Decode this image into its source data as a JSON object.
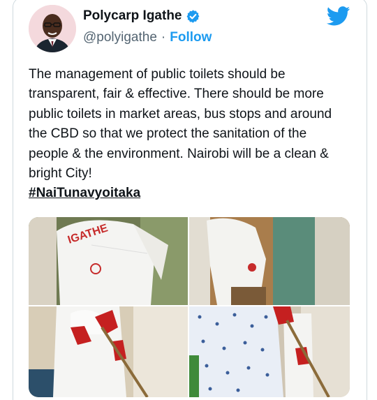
{
  "author": {
    "display_name": "Polycarp Igathe",
    "handle": "@polyigathe",
    "separator": "·",
    "follow_label": "Follow",
    "verified": true
  },
  "tweet": {
    "text": "The management of public toilets should be transparent, fair & effective. There should be more public toilets in market areas, bus stops and around the CBD so that we protect the sanitation of the people & the environment. Nairobi will be a clean & bright City!",
    "hashtag": "#NaiTunavyoitaka"
  },
  "media": {
    "photos": [
      {
        "icon": "photo-coat-back",
        "coat_print": "IGATHE"
      },
      {
        "icon": "photo-cleaning-stall"
      },
      {
        "icon": "photo-red-gloves-scrubbing"
      },
      {
        "icon": "photo-patterned-shirt"
      }
    ]
  },
  "icons": {
    "brand": "twitter-bird-icon",
    "badge": "verified-badge-icon"
  },
  "colors": {
    "accent": "#1d9bf0",
    "text": "#0f1419",
    "secondary": "#536471",
    "border": "#cfd9de"
  }
}
